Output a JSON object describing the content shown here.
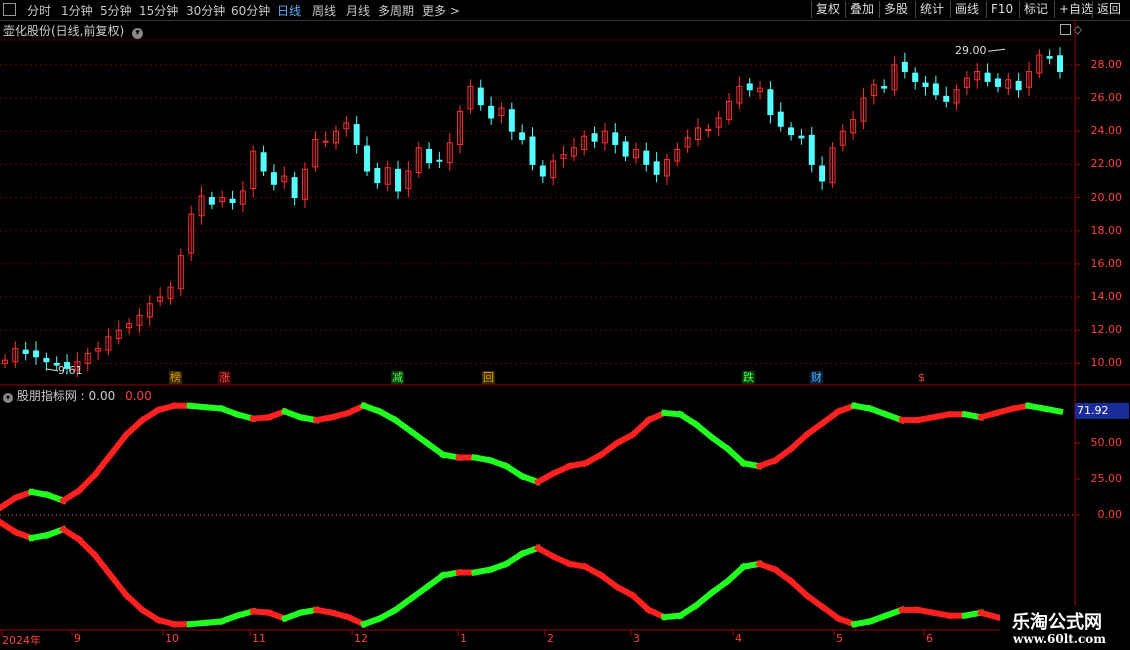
{
  "toolbar": {
    "left_tabs": [
      "分时",
      "1分钟",
      "5分钟",
      "15分钟",
      "30分钟",
      "60分钟",
      "日线",
      "周线",
      "月线",
      "多周期",
      "更多 >"
    ],
    "active_tab": "日线",
    "right_buttons": [
      "复权",
      "叠加",
      "多股",
      "统计",
      "画线",
      "F10",
      "标记",
      "+自选",
      "返回"
    ]
  },
  "main_panel": {
    "title": "壶化股份(日线,前复权)",
    "y_ticks": [
      "28.00",
      "26.00",
      "24.00",
      "22.00",
      "20.00",
      "18.00",
      "16.00",
      "14.00",
      "12.00",
      "10.00"
    ],
    "high_label": "29.00",
    "low_label": "9.61",
    "markers": [
      {
        "text": "榜",
        "color": "#e0a000",
        "bg": "#3a2a00"
      },
      {
        "text": "涨",
        "color": "#ff5050",
        "bg": "#3a0000"
      },
      {
        "text": "减",
        "color": "#50ff50",
        "bg": "#003a00"
      },
      {
        "text": "回",
        "color": "#e0a000",
        "bg": "#3a2a00"
      },
      {
        "text": "跌",
        "color": "#50ff50",
        "bg": "#003a00"
      },
      {
        "text": "财",
        "color": "#5ab0ff",
        "bg": "#00203a"
      },
      {
        "text": "$",
        "color": "#ff4040",
        "bg": "transparent"
      }
    ]
  },
  "indicator_panel": {
    "name": "股朋指标网",
    "value1": ": 0.00",
    "value2": "0.00",
    "y_ticks": [
      "50.00",
      "25.00",
      "0.00"
    ],
    "current_value": "71.92"
  },
  "date_axis": [
    "2024年",
    "9",
    "10",
    "11",
    "12",
    "1",
    "2",
    "3",
    "4",
    "5",
    "6"
  ],
  "logo": {
    "name": "乐淘公式网",
    "url": "www.60lt.com"
  },
  "colors": {
    "up": "#ff3030",
    "down": "#54ffff",
    "line_up": "#ff2020",
    "line_down": "#20ff20",
    "grid": "#6a0000"
  },
  "chart_data": {
    "type": "candlestick",
    "price_closes": [
      10.2,
      10.9,
      10.6,
      10.4,
      10.1,
      9.9,
      9.7,
      10.1,
      10.6,
      10.9,
      11.6,
      12.0,
      12.4,
      12.9,
      13.6,
      14.0,
      14.6,
      16.5,
      19.0,
      20.1,
      19.6,
      20.0,
      19.7,
      20.4,
      22.8,
      21.6,
      20.8,
      21.3,
      20.0,
      21.7,
      23.5,
      23.4,
      24.0,
      24.5,
      23.2,
      21.6,
      20.9,
      21.8,
      20.4,
      21.6,
      23.0,
      22.1,
      22.2,
      23.3,
      25.2,
      26.7,
      25.6,
      24.8,
      25.4,
      24.0,
      23.5,
      22.0,
      21.3,
      22.2,
      22.6,
      23.0,
      23.7,
      23.4,
      24.0,
      23.2,
      22.5,
      22.9,
      22.0,
      21.4,
      22.3,
      22.9,
      23.6,
      24.2,
      24.1,
      24.8,
      25.8,
      26.7,
      26.5,
      26.6,
      25.0,
      24.3,
      23.8,
      23.6,
      22.0,
      21.0,
      23.0,
      24.0,
      24.7,
      26.0,
      26.8,
      26.6,
      28.0,
      27.6,
      27.0,
      26.7,
      26.2,
      25.8,
      26.5,
      27.2,
      27.6,
      27.0,
      26.7,
      27.1,
      26.5,
      27.6,
      28.6,
      28.4,
      27.6
    ],
    "price_range": [
      9.61,
      29.0
    ],
    "indicator_upper": [
      5,
      12,
      16,
      14,
      10,
      17,
      28,
      42,
      56,
      66,
      73,
      76,
      76,
      75,
      74,
      70,
      67,
      68,
      72,
      68,
      66,
      68,
      71,
      76,
      72,
      66,
      58,
      50,
      42,
      40,
      40,
      38,
      34,
      27,
      23,
      29,
      34,
      36,
      42,
      50,
      56,
      66,
      71,
      70,
      63,
      54,
      46,
      36,
      34,
      38,
      46,
      56,
      64,
      72,
      76,
      74,
      70,
      66,
      66,
      68,
      70,
      70,
      68,
      71,
      74,
      76,
      74,
      72
    ],
    "indicator_lower": [
      -5,
      -12,
      -16,
      -14,
      -10,
      -17,
      -28,
      -42,
      -56,
      -66,
      -73,
      -76,
      -76,
      -75,
      -74,
      -70,
      -67,
      -68,
      -72,
      -68,
      -66,
      -68,
      -71,
      -76,
      -72,
      -66,
      -58,
      -50,
      -42,
      -40,
      -40,
      -38,
      -34,
      -27,
      -23,
      -29,
      -34,
      -36,
      -42,
      -50,
      -56,
      -66,
      -71,
      -70,
      -63,
      -54,
      -46,
      -36,
      -34,
      -38,
      -46,
      -56,
      -64,
      -72,
      -76,
      -74,
      -70,
      -66,
      -66,
      -68,
      -70,
      -70,
      -68,
      -71,
      -74,
      -76,
      -74,
      -72
    ],
    "indicator_range": [
      -80,
      80
    ]
  }
}
